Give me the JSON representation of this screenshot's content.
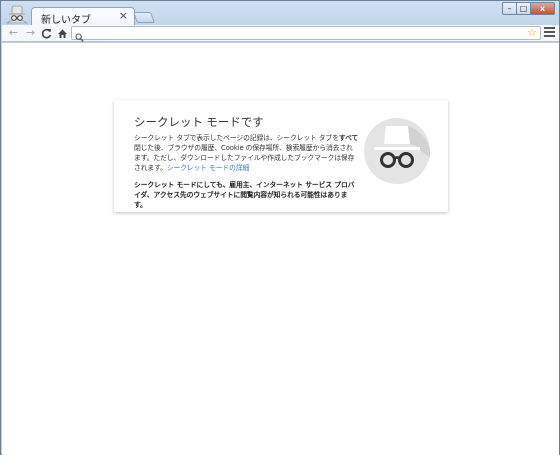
{
  "tab": {
    "title": "新しいタブ",
    "close_glyph": "×"
  },
  "window_controls": {
    "minimize": "–",
    "maximize": "□",
    "close": "x"
  },
  "toolbar": {
    "back_glyph": "←",
    "forward_glyph": "→",
    "reload_glyph": "C",
    "home_glyph": "⌂",
    "omnibox_value": "",
    "star_glyph": "☆"
  },
  "incognito": {
    "title": "シークレット モードです",
    "body_1": "シークレット タブで表示したページの記録は、シークレット タブを",
    "body_bold": "すべて",
    "body_2": "閉じた後、ブラウザの履歴、Cookie の保存場所、検索履歴から消去されます。ただし、ダウンロードしたファイルや作成したブックマークは保存されます。",
    "learn_more": "シークレット モードの詳細",
    "warning": "シークレット モードにしても、雇用主、インターネット サービス プロバイダ、アクセス先のウェブサイトに閲覧内容が知られる可能性はあります。"
  },
  "icons": {
    "avatar": "incognito-avatar-icon",
    "illustration": "incognito-spy-icon",
    "search": "search-icon",
    "menu": "hamburger-menu-icon"
  },
  "colors": {
    "frame": "#b9cfe6",
    "link": "#3b73c9",
    "star": "#e8a100",
    "illustration_bg": "#e4e4e4"
  }
}
